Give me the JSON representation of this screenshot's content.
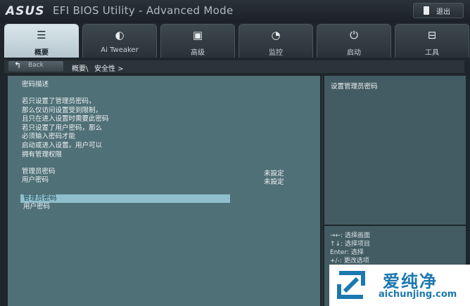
{
  "titlebar": {
    "brand": "ASUS",
    "title": "EFI BIOS Utility - Advanced Mode",
    "exit_label": "退出",
    "exit_icon": "exit-door-icon"
  },
  "tabs": [
    {
      "label": "概要",
      "icon": "list-icon",
      "glyph": "☰",
      "active": true
    },
    {
      "label": "Ai Tweaker",
      "icon": "tweaker-icon",
      "glyph": "◐",
      "active": false
    },
    {
      "label": "高级",
      "icon": "advanced-icon",
      "glyph": "▣",
      "active": false
    },
    {
      "label": "监控",
      "icon": "monitor-icon",
      "glyph": "◔",
      "active": false
    },
    {
      "label": "启动",
      "icon": "power-icon",
      "glyph": "⏻",
      "active": false
    },
    {
      "label": "工具",
      "icon": "tool-icon",
      "glyph": "⊟",
      "active": false
    }
  ],
  "breadcrumb": {
    "back_label": "Back",
    "level1": "概要\\",
    "level2": "安全性 >"
  },
  "main": {
    "section_title": "密码描述",
    "description": [
      "若只设置了管理员密码，",
      "那么仅访问设置受到限制，",
      "且只在进入设置时需要此密码",
      "若只设置了用户密码，那么",
      "必须输入密码才能",
      "启动或进入设置。用户可以",
      "拥有管理权限"
    ],
    "status": [
      {
        "label": "管理员密码",
        "value": "未設定"
      },
      {
        "label": "用户密码",
        "value": "未設定"
      }
    ],
    "menu": [
      {
        "label": "管理员密码",
        "selected": true
      },
      {
        "label": "用户密码",
        "selected": false
      }
    ]
  },
  "help": {
    "text": "设置管理员密码"
  },
  "keys": [
    "→←: 选择画面",
    "↑↓: 选择项目",
    "Enter: 选择",
    "+/-: 更改选项"
  ],
  "watermark": {
    "cn": "爱纯净",
    "url": "aichunjing.com"
  },
  "colors": {
    "accent": "#8fbfcc",
    "panel": "#507077",
    "watermark": "#1b78b0"
  }
}
